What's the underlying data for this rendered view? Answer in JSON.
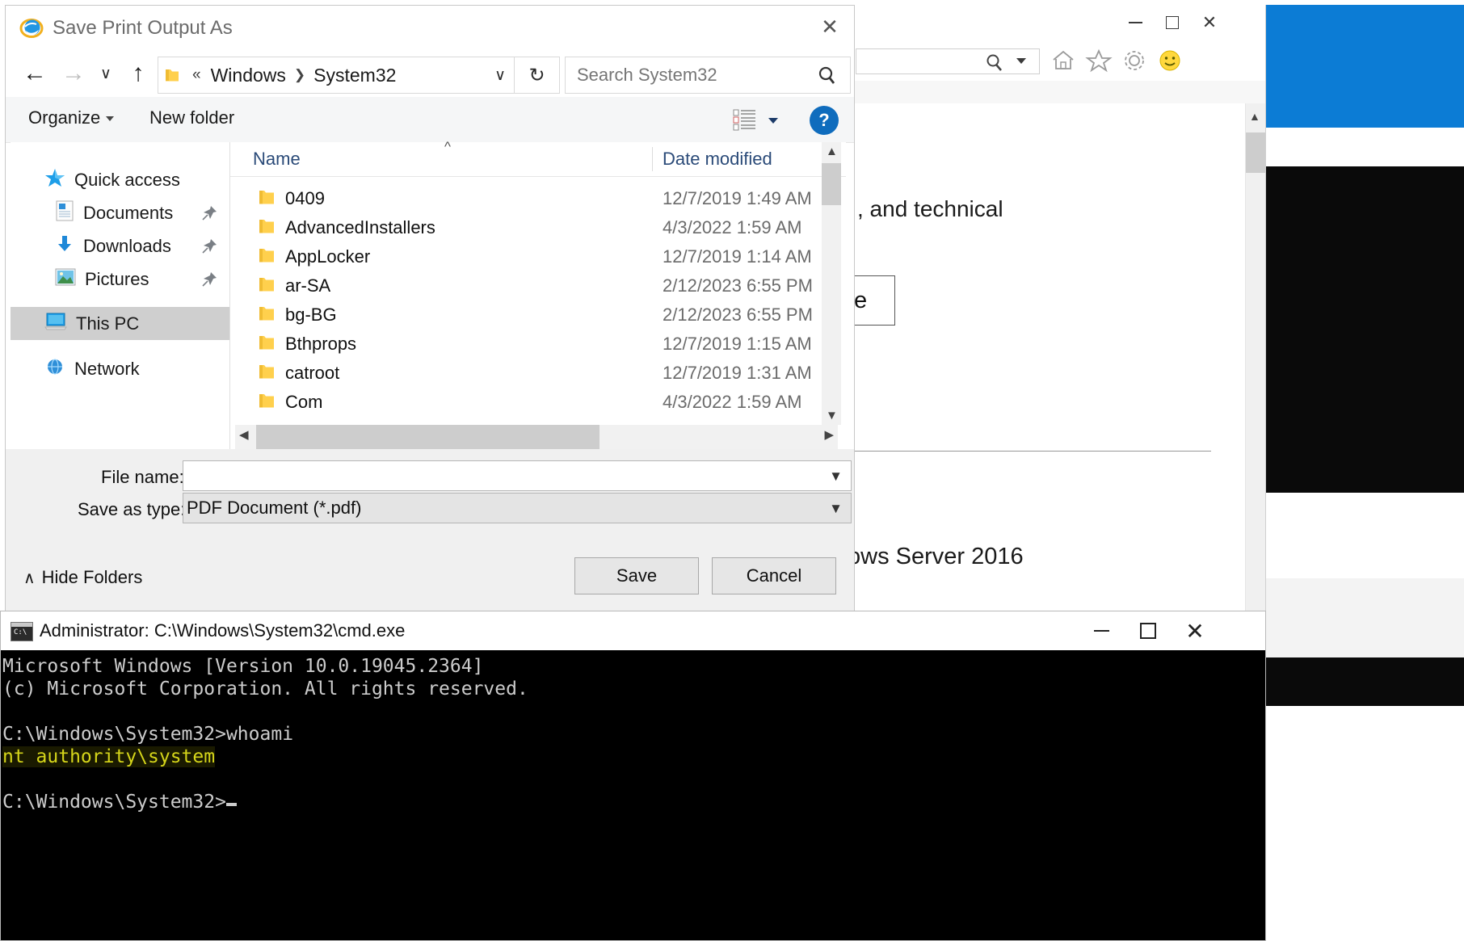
{
  "save_dialog": {
    "title": "Save Print Output As",
    "titlebar_icon": "internet-explorer-logo",
    "close_label": "✕",
    "nav": {
      "back": "←",
      "forward": "→",
      "recent": "∨",
      "up": "↑"
    },
    "address": {
      "folder_icon": "folder-icon",
      "prefix": "«",
      "crumb1": "Windows",
      "separator": "❯",
      "crumb2": "System32",
      "dropdown": "∨"
    },
    "refresh_label": "↻",
    "search": {
      "placeholder": "Search System32",
      "icon": "search-icon"
    },
    "command_bar": {
      "organize": "Organize",
      "new_folder": "New folder",
      "view_icon": "view-list-icon",
      "help_label": "?"
    },
    "nav_pane": [
      {
        "label": "Quick access",
        "icon": "star-pin-icon",
        "pinned": false,
        "selected": false
      },
      {
        "label": "Documents",
        "icon": "documents-icon",
        "pinned": true,
        "selected": false
      },
      {
        "label": "Downloads",
        "icon": "download-arrow-icon",
        "pinned": true,
        "selected": false
      },
      {
        "label": "Pictures",
        "icon": "pictures-icon",
        "pinned": true,
        "selected": false
      },
      {
        "label": "This PC",
        "icon": "this-pc-icon",
        "pinned": false,
        "selected": true
      },
      {
        "label": "Network",
        "icon": "network-icon",
        "pinned": false,
        "selected": false
      }
    ],
    "columns": {
      "name": "Name",
      "date_modified": "Date modified"
    },
    "files": [
      {
        "name": "0409",
        "date": "12/7/2019 1:49 AM"
      },
      {
        "name": "AdvancedInstallers",
        "date": "4/3/2022 1:59 AM"
      },
      {
        "name": "AppLocker",
        "date": "12/7/2019 1:14 AM"
      },
      {
        "name": "ar-SA",
        "date": "2/12/2023 6:55 PM"
      },
      {
        "name": "bg-BG",
        "date": "2/12/2023 6:55 PM"
      },
      {
        "name": "Bthprops",
        "date": "12/7/2019 1:15 AM"
      },
      {
        "name": "catroot",
        "date": "12/7/2019 1:31 AM"
      },
      {
        "name": "Com",
        "date": "4/3/2022 1:59 AM"
      }
    ],
    "form": {
      "file_name_label": "File name:",
      "file_name_value": "",
      "save_as_type_label": "Save as type:",
      "save_as_type_value": "PDF Document (*.pdf)"
    },
    "footer": {
      "hide_folders": "Hide Folders",
      "hide_folders_caret": "∧",
      "save": "Save",
      "cancel": "Cancel"
    }
  },
  "ie_window": {
    "minimize": "—",
    "maximize": "□",
    "close": "✕",
    "toolbar_icons": [
      "search-icon",
      "home-icon",
      "favorites-star-icon",
      "settings-gear-icon",
      "smiley-feedback-icon"
    ],
    "page": {
      "text_fragment_1": ", and technical",
      "button_fragment": "e",
      "text_fragment_2": "ows Server 2016"
    }
  },
  "cmd_window": {
    "title": "Administrator: C:\\Windows\\System32\\cmd.exe",
    "minimize": "—",
    "maximize": "□",
    "close": "✕",
    "line1": "Microsoft Windows [Version 10.0.19045.2364]",
    "line2": "(c) Microsoft Corporation. All rights reserved.",
    "line3": "",
    "prompt1": "C:\\Windows\\System32>",
    "command1": "whoami",
    "output1": "nt authority\\system",
    "line_blank": "",
    "prompt2": "C:\\Windows\\System32>"
  },
  "colors": {
    "accent_blue": "#0f6cbd",
    "desktop_blue": "#0c7cd5",
    "selection_gray": "#cfcfcf",
    "cmd_output_yellow": "#d6d61a",
    "folder_yellow": "#ffd04d"
  }
}
